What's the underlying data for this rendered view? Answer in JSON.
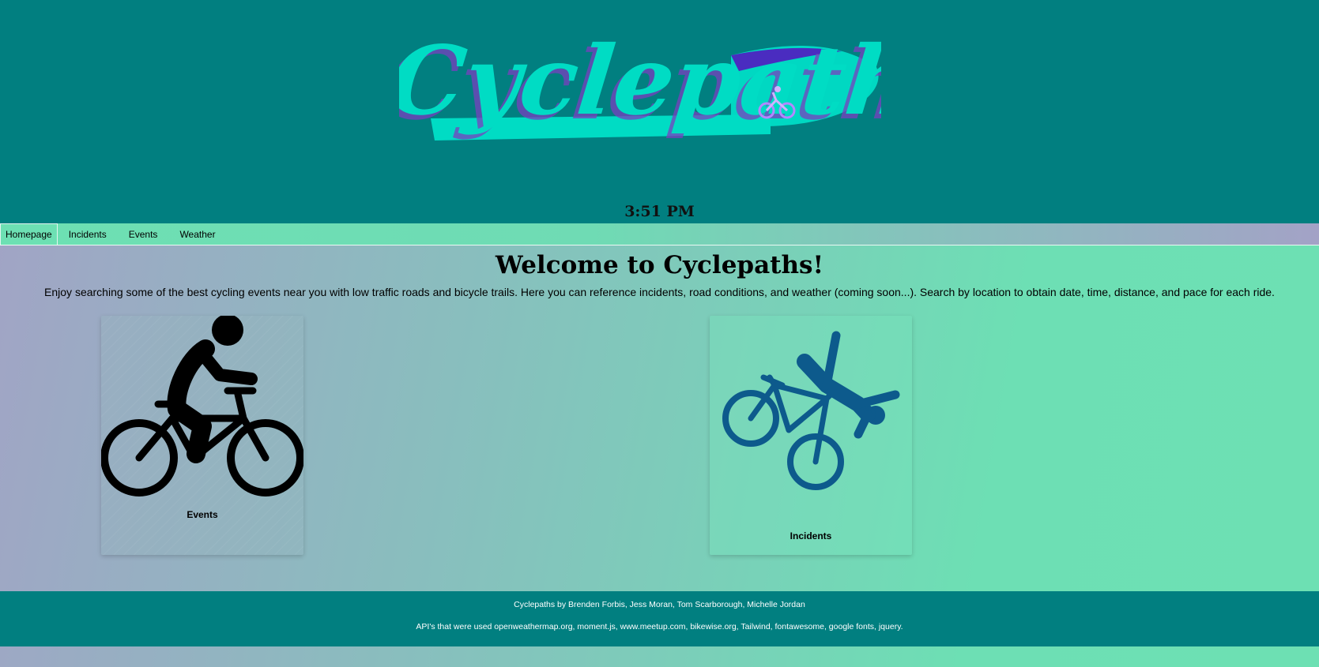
{
  "header": {
    "logo_text": "Cyclepaths",
    "clock": "3:51 PM"
  },
  "nav": {
    "items": [
      {
        "label": "Homepage"
      },
      {
        "label": "Incidents"
      },
      {
        "label": "Events"
      },
      {
        "label": "Weather"
      }
    ]
  },
  "main": {
    "title": "Welcome to Cyclepaths!",
    "intro": "Enjoy searching some of the best cycling events near you with low traffic roads and bicycle trails. Here you can reference incidents, road conditions, and weather (coming soon...). Search by location to obtain date, time, distance, and pace for each ride.",
    "cards": [
      {
        "label": "Events",
        "icon": "cyclist-icon"
      },
      {
        "label": "Incidents",
        "icon": "crash-icon"
      }
    ]
  },
  "footer": {
    "credits": "Cyclepaths by Brenden Forbis, Jess Moran, Tom Scarborough, Michelle Jordan",
    "apis": "API's that were used openweathermap.org, moment.js, www.meetup.com, bikewise.org, Tailwind, fontawesome, google fonts, jquery."
  },
  "colors": {
    "header_bg": "#017f80",
    "logo_fill": "#00dcc4",
    "logo_shadow": "#7a3fbf",
    "incident_icon": "#0d5a8c"
  }
}
